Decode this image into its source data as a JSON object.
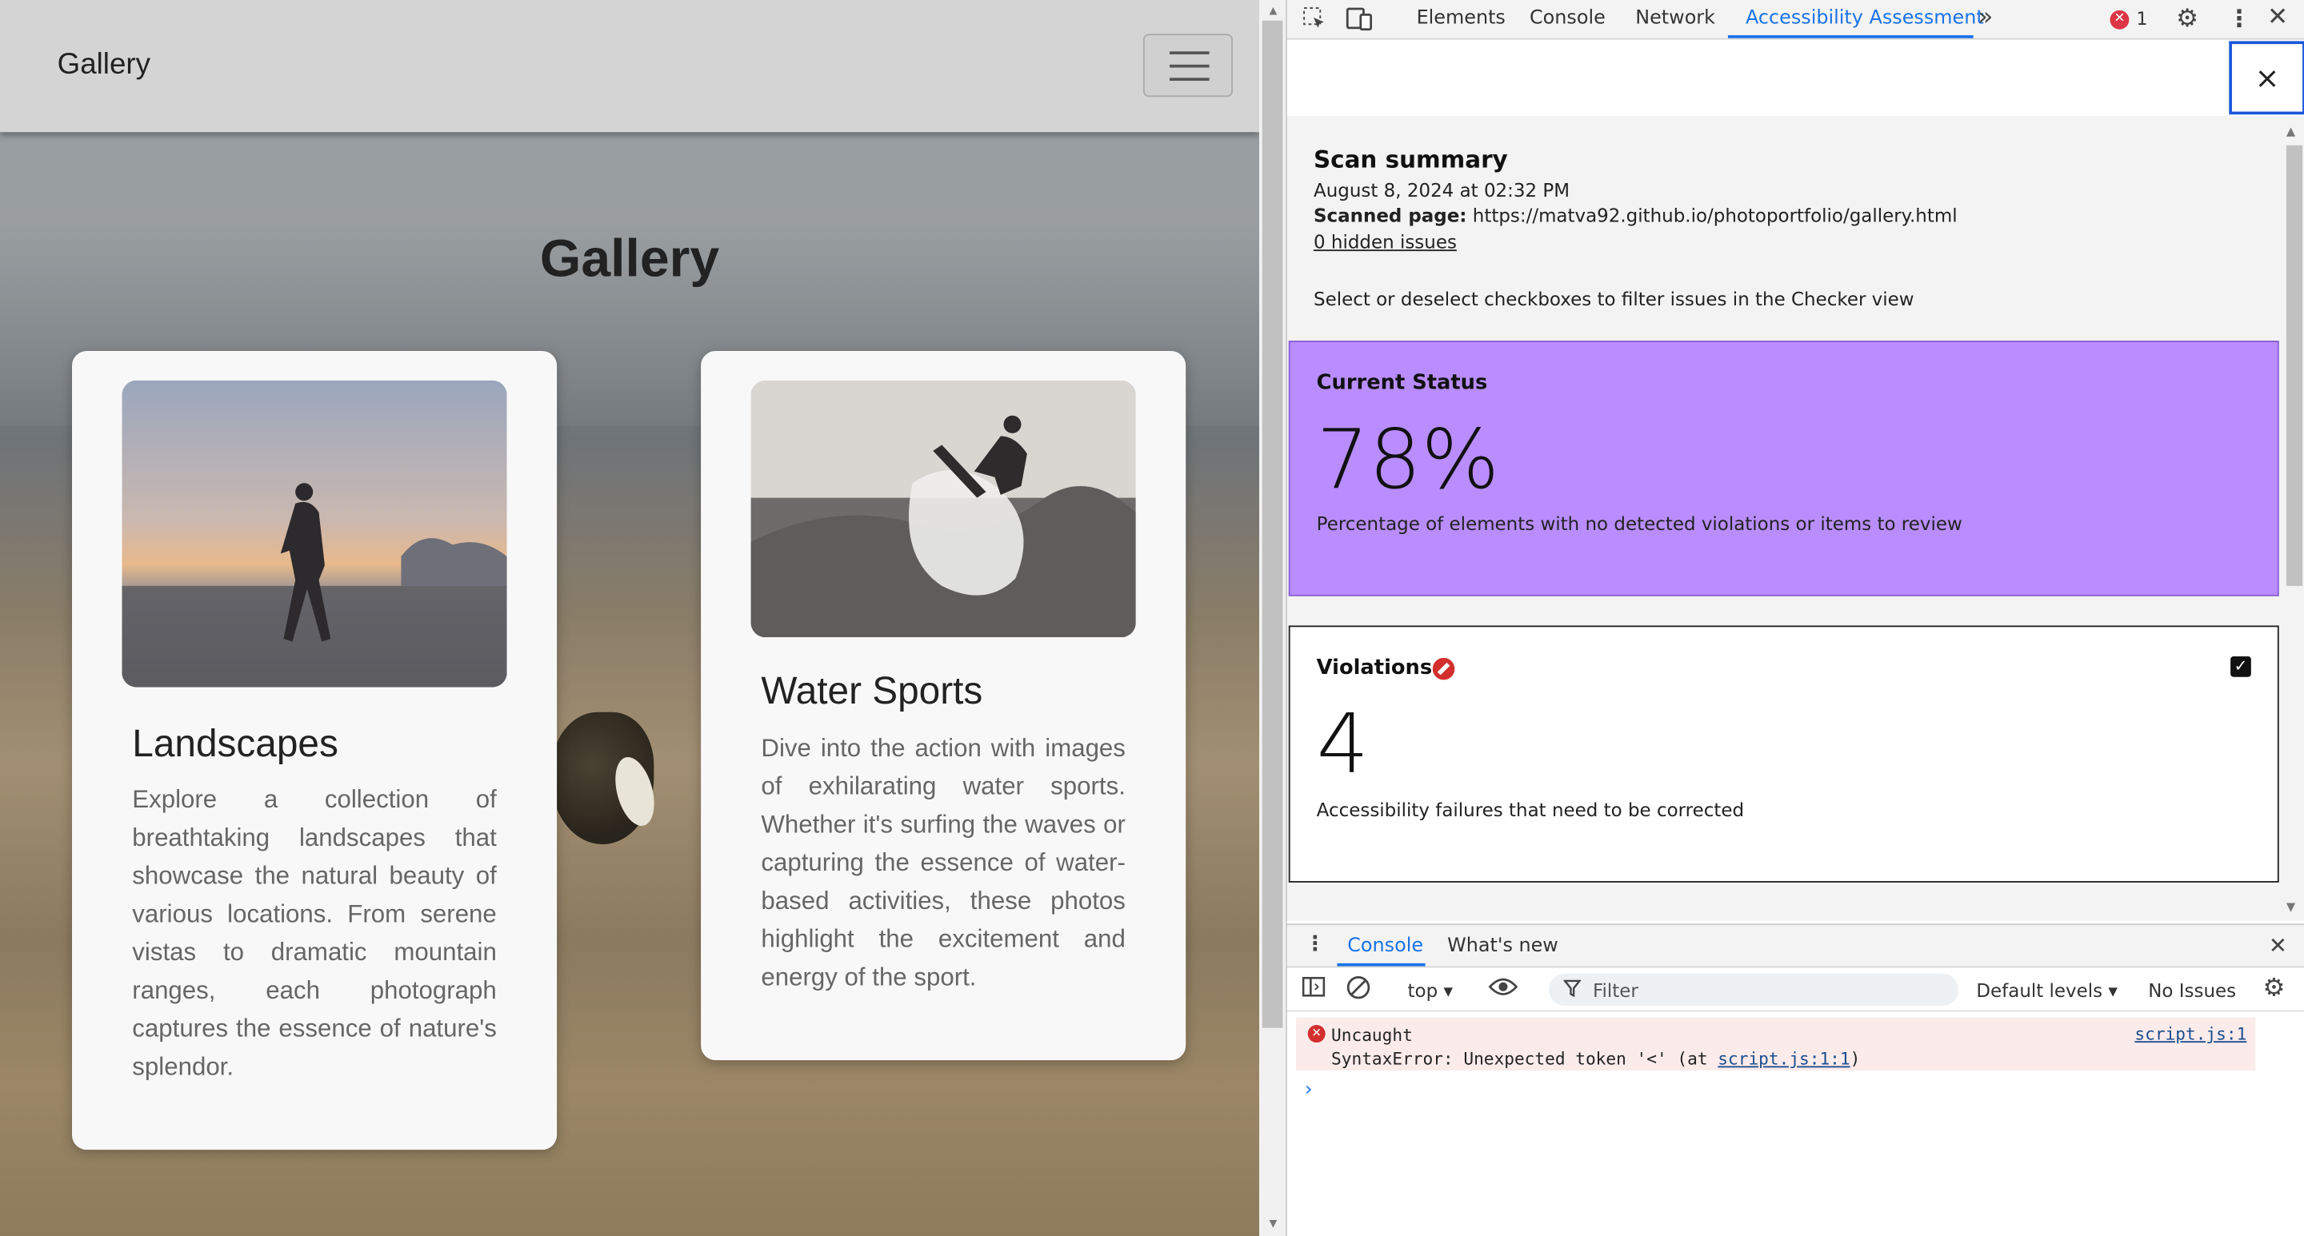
{
  "site": {
    "brand": "Gallery",
    "heading": "Gallery",
    "cards": [
      {
        "title": "Landscapes",
        "description": "Explore a collection of breathtaking landscapes that showcase the natural beauty of various locations. From serene vistas to dramatic mountain ranges, each photograph captures the essence of nature's splendor."
      },
      {
        "title": "Water Sports",
        "description": "Dive into the action with images of exhilarating water sports. Whether it's surfing the waves or capturing the essence of water-based activities, these photos highlight the excitement and energy of the sport."
      }
    ]
  },
  "devtools": {
    "tabs": [
      "Elements",
      "Console",
      "Network",
      "Accessibility Assessment"
    ],
    "active_tab": "Accessibility Assessment",
    "more_tabs_icon": "chevron-double-right-icon",
    "error_count": "1",
    "close_icon_glyph": "×",
    "scan": {
      "title": "Scan summary",
      "date": "August 8, 2024 at 02:32 PM",
      "scanned_label": "Scanned page:",
      "scanned_url": "https://matva92.github.io/photoportfolio/gallery.html",
      "hidden_issues": "0 hidden issues",
      "instructions": "Select or deselect checkboxes to filter issues in the Checker view"
    },
    "status": {
      "title": "Current Status",
      "value": "78%",
      "description": "Percentage of elements with no detected violations or items to review",
      "color": "#b98dfd"
    },
    "violations": {
      "title": "Violations",
      "value": "4",
      "description": "Accessibility failures that need to be corrected",
      "checked": true
    },
    "drawer": {
      "tabs": [
        "Console",
        "What's new"
      ],
      "context": "top",
      "filter_placeholder": "Filter",
      "levels": "Default levels",
      "issues": "No Issues",
      "error": {
        "line1": "Uncaught",
        "line2_prefix": "SyntaxError: Unexpected token '<' (at ",
        "line2_link": "script.js:1:1",
        "line2_suffix": ")",
        "source": "script.js:1"
      },
      "prompt": "›"
    }
  }
}
